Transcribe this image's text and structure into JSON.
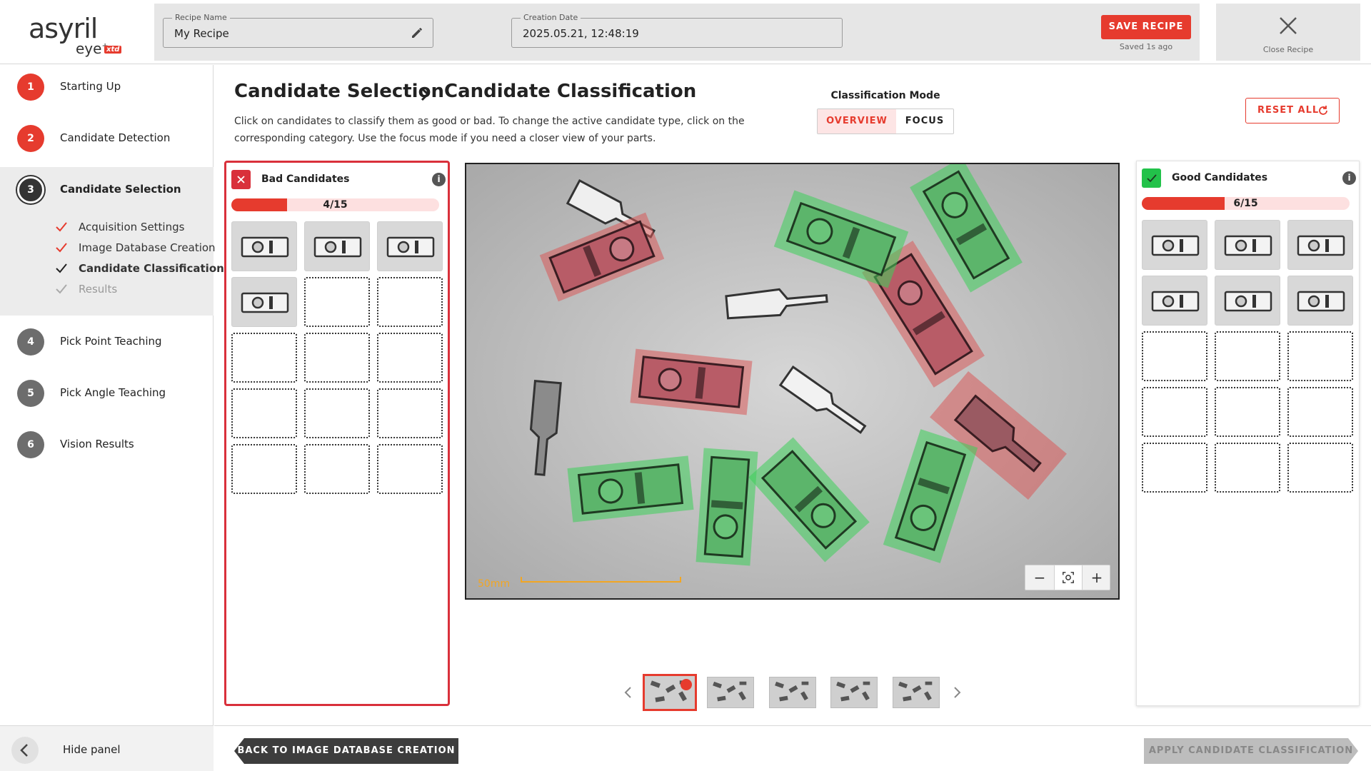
{
  "colors": {
    "accent": "#e63b2e",
    "good": "#22c24a",
    "bad_frame": "#d9303b",
    "sidebar_active": "#ececec"
  },
  "header": {
    "logo_word": "asyril",
    "logo_eye": "eye",
    "logo_plus": "+",
    "logo_xtd": "xtd",
    "recipe_name_label": "Recipe Name",
    "recipe_name_value": "My Recipe",
    "creation_date_label": "Creation Date",
    "creation_date_value": "2025.05.21, 12:48:19",
    "save_label": "SAVE RECIPE",
    "saved_ago": "Saved 1s ago",
    "close_label": "Close Recipe"
  },
  "sidebar": {
    "steps": [
      {
        "num": "1",
        "label": "Starting Up",
        "status": "done"
      },
      {
        "num": "2",
        "label": "Candidate Detection",
        "status": "done"
      },
      {
        "num": "3",
        "label": "Candidate Selection",
        "status": "active"
      },
      {
        "num": "4",
        "label": "Pick Point Teaching",
        "status": "todo"
      },
      {
        "num": "5",
        "label": "Pick Angle Teaching",
        "status": "todo"
      },
      {
        "num": "6",
        "label": "Vision Results",
        "status": "todo"
      }
    ],
    "substeps": [
      {
        "label": "Acquisition Settings",
        "state": "done"
      },
      {
        "label": "Image Database Creation",
        "state": "done"
      },
      {
        "label": "Candidate Classification",
        "state": "current"
      },
      {
        "label": "Results",
        "state": "pending"
      }
    ],
    "hide_label": "Hide panel"
  },
  "main": {
    "crumb_parent": "Candidate Selection",
    "crumb_current": "Candidate Classification",
    "description": "Click on candidates to classify them as good or bad. To change the active candidate type, click on the corresponding category. Use the focus mode if you need a closer view of your parts.",
    "mode_title": "Classification Mode",
    "mode_overview": "OVERVIEW",
    "mode_focus": "FOCUS",
    "mode_selected": "OVERVIEW",
    "reset_label": "RESET ALL"
  },
  "bad": {
    "title": "Bad Candidates",
    "count_text": "4/15",
    "progress": 0.267,
    "filled": 4,
    "slots": 15
  },
  "good": {
    "title": "Good Candidates",
    "count_text": "6/15",
    "progress": 0.4,
    "filled": 6,
    "slots": 15
  },
  "viewer": {
    "scale_label": "50mm",
    "zoom_out": "−",
    "zoom_in": "+"
  },
  "thumbnails": {
    "count": 5,
    "active_index": 0
  },
  "footer": {
    "back_label": "BACK TO IMAGE DATABASE CREATION",
    "apply_label": "APPLY CANDIDATE CLASSIFICATION"
  }
}
